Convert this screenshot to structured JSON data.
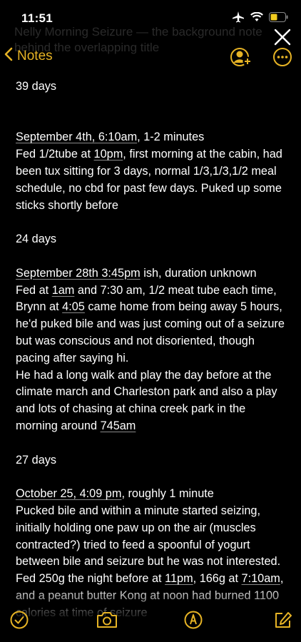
{
  "status": {
    "time": "11:51"
  },
  "nav": {
    "back_label": "Notes"
  },
  "ghost": {
    "text": "Nelly Morning Seizure — the background note behind the overlapping title"
  },
  "entries": [
    {
      "heading": "39 days"
    },
    {
      "title_underlined": "September 4th, 6:10am",
      "title_rest": ", 1-2 minutes",
      "p1": "Fed 1/2tube at ",
      "p1_u": "10pm",
      "p1_rest": ", first morning at the cabin, had been tux sitting for 3 days, normal 1/3,1/3,1/2 meal schedule, no cbd for past few days. Puked up some sticks shortly before"
    },
    {
      "heading": "24 days"
    },
    {
      "title_underlined": "September 28th 3:45pm",
      "title_rest": " ish, duration unknown",
      "a1": "Fed at ",
      "a1_u": "1am",
      "a2": " and 7:30 am, 1/2 meat tube each time, Brynn at ",
      "a2_u": "4:05",
      "a3": " came home from being away 5 hours, he'd puked bile and was just coming out of a seizure but was conscious and not disoriented, though pacing after saying hi.",
      "b1": "He had a long walk and play the day before at the climate march and Charleston park and also a play and lots of chasing at china creek park in the morning around ",
      "b1_u": "745am"
    },
    {
      "heading": "27 days"
    },
    {
      "title_underlined": "October 25, 4:09 pm",
      "title_rest": ", roughly 1 minute",
      "c1": "Pucked bile and within a minute started seizing, initially holding one paw up on the air (muscles contracted?) tried to feed a spoonful of yogurt between bile and seizure but he was not interested. Fed 250g the night before at ",
      "c1_u": "11pm",
      "c2": ", 166g at ",
      "c2_u": "7:10am",
      "c3": ", and a peanut butter Kong at noon had burned 1100 calories at time of seizure"
    }
  ],
  "toolbar": {
    "icons": [
      "checklist-icon",
      "camera-icon",
      "markup-icon",
      "compose-icon"
    ]
  },
  "colors": {
    "accent": "#e6b325",
    "background": "#000000",
    "text": "#ffffff"
  }
}
